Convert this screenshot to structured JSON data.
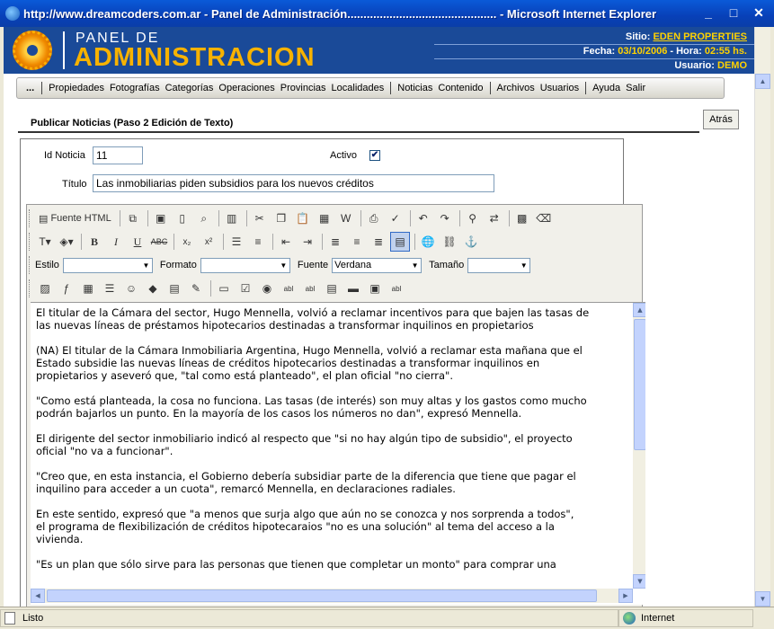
{
  "window": {
    "title": "http://www.dreamcoders.com.ar - Panel de Administración.............................................. - Microsoft Internet Explorer",
    "minimize": "_",
    "maximize": "□",
    "close": "✕"
  },
  "header": {
    "logo_small": "PANEL DE",
    "logo_big": "ADMINISTRACION",
    "sitio_label": "Sitio:",
    "sitio_value": "EDEN PROPERTIES",
    "fecha_label": "Fecha:",
    "fecha_value": "03/10/2006",
    "hora_label": "- Hora:",
    "hora_value": "02:55 hs.",
    "usuario_label": "Usuario:",
    "usuario_value": "DEMO"
  },
  "nav": {
    "dots": "...",
    "items": [
      "Propiedades",
      "Fotografías",
      "Categorías",
      "Operaciones",
      "Provincias",
      "Localidades",
      "Noticias",
      "Contenido",
      "Archivos",
      "Usuarios",
      "Ayuda",
      "Salir"
    ]
  },
  "section": {
    "title": "Publicar Noticias (Paso 2 Edición de Texto)",
    "back_label": "Atrás"
  },
  "form": {
    "id_label": "Id Noticia",
    "id_value": "11",
    "activo_label": "Activo",
    "activo_checked": true,
    "titulo_label": "Título",
    "titulo_value": "Las inmobiliarias piden subsidios para los nuevos créditos"
  },
  "editor": {
    "source_label": "Fuente HTML",
    "estilo_label": "Estilo",
    "estilo_value": "",
    "formato_label": "Formato",
    "formato_value": "",
    "fuente_label": "Fuente",
    "fuente_value": "Verdana",
    "tamano_label": "Tamaño",
    "tamano_value": "",
    "paragraphs": [
      "El titular de la Cámara del sector, Hugo Mennella, volvió a reclamar incentivos para que bajen las tasas de",
      "las nuevas líneas de préstamos hipotecarios destinadas a transformar inquilinos en propietarios",
      "(NA) El titular de la Cámara Inmobiliaria Argentina, Hugo Mennella, volvió a reclamar esta mañana que el",
      "Estado subsidie las nuevas líneas de créditos hipotecarios destinadas a transformar inquilinos en",
      "propietarios y aseveró que, \"tal como está planteado\", el plan oficial \"no cierra\".",
      "\"Como está planteada, la cosa no funciona. Las tasas (de interés) son muy altas y los gastos como mucho",
      "podrán bajarlos un punto. En la mayoría de los casos los números no dan\", expresó Mennella.",
      "El dirigente del sector inmobiliario indicó al respecto que \"si no hay algún tipo de subsidio\", el proyecto",
      "oficial \"no va a funcionar\".",
      "\"Creo que, en esta instancia, el Gobierno debería subsidiar parte de la diferencia que tiene que pagar el",
      "inquilino para acceder a un cuota\", remarcó Mennella, en declaraciones radiales.",
      "En este sentido, expresó que \"a menos que surja algo que aún no se conozca y nos sorprenda a todos\",",
      "el programa de flexibilización de créditos hipotecaraios \"no es una solución\" al tema del acceso a la",
      "vivienda.",
      "\"Es un plan que sólo sirve para las personas que tienen que completar un monto\" para comprar una"
    ]
  },
  "status": {
    "left": "Listo",
    "zone": "Internet"
  }
}
